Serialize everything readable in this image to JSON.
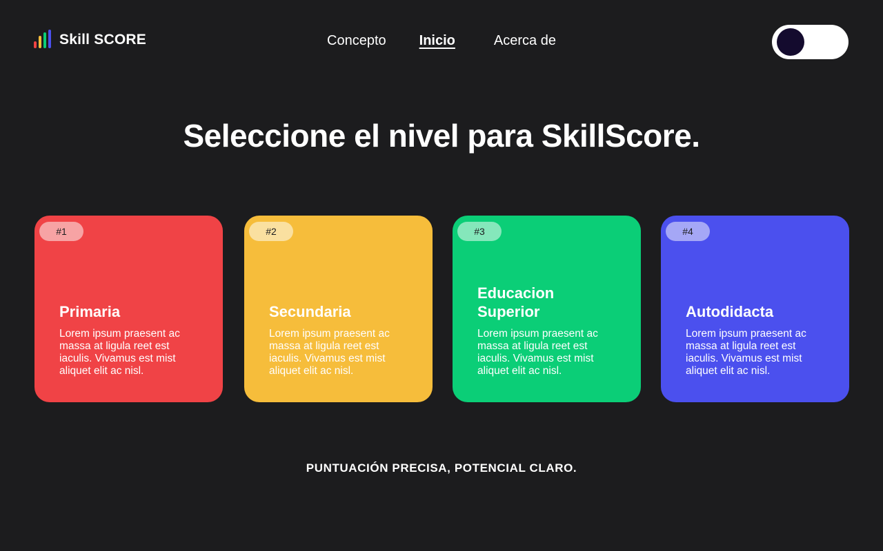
{
  "header": {
    "logo": {
      "text_skill": "Skill",
      "text_score": "SCORE",
      "bar_colors": [
        "#ef4444",
        "#f6bd3b",
        "#0bce77",
        "#4b50ee"
      ]
    },
    "nav": {
      "items": [
        {
          "label": "Concepto"
        },
        {
          "label": "Inicio",
          "active": true
        },
        {
          "label": "Acerca de"
        }
      ]
    },
    "theme_toggle": {
      "track_color": "#ffffff",
      "knob_color": "#140b2e"
    }
  },
  "main": {
    "headline": "Seleccione el nivel para SkillScore.",
    "cards": [
      {
        "badge": "#1",
        "title": "Primaria",
        "description": "Lorem ipsum praesent ac massa at ligula reet est iaculis. Vivamus est mist aliquet elit ac nisl.",
        "color": "#f04346",
        "badge_color": "#f7a3a4"
      },
      {
        "badge": "#2",
        "title": "Secundaria",
        "description": "Lorem ipsum praesent ac massa at ligula reet est iaculis. Vivamus est mist aliquet elit ac nisl.",
        "color": "#f6bd3b",
        "badge_color": "#fae0a0"
      },
      {
        "badge": "#3",
        "title": "Educacion Superior",
        "description": "Lorem ipsum praesent ac massa at ligula reet est iaculis. Vivamus est mist aliquet elit ac nisl.",
        "color": "#0bce77",
        "badge_color": "#85e7bb"
      },
      {
        "badge": "#4",
        "title": "Autodidacta",
        "description": "Lorem ipsum praesent ac massa at ligula reet est iaculis. Vivamus est mist aliquet elit ac nisl.",
        "color": "#4b50ee",
        "badge_color": "#a5a7f6"
      }
    ]
  },
  "footer": {
    "tagline": "PUNTUACIÓN PRECISA, POTENCIAL CLARO."
  }
}
